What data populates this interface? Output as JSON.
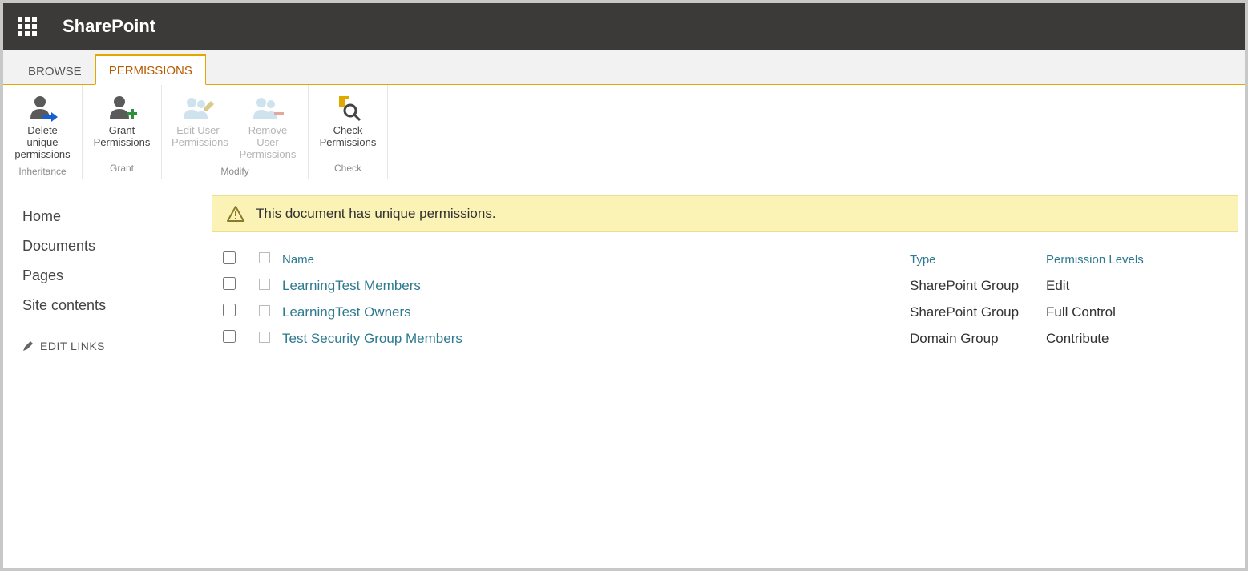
{
  "suite": {
    "title": "SharePoint"
  },
  "tabs": {
    "browse": "BROWSE",
    "permissions": "PERMISSIONS"
  },
  "ribbon": {
    "deleteUnique": {
      "line1": "Delete unique",
      "line2": "permissions"
    },
    "grant": {
      "line1": "Grant",
      "line2": "Permissions"
    },
    "editUser": {
      "line1": "Edit User",
      "line2": "Permissions"
    },
    "removeUser": {
      "line1": "Remove User",
      "line2": "Permissions"
    },
    "check": {
      "line1": "Check",
      "line2": "Permissions"
    },
    "groups": {
      "inheritance": "Inheritance",
      "grant": "Grant",
      "modify": "Modify",
      "check": "Check"
    }
  },
  "nav": {
    "items": [
      "Home",
      "Documents",
      "Pages",
      "Site contents"
    ],
    "editLinks": "EDIT LINKS"
  },
  "notice": {
    "text": "This document has unique permissions."
  },
  "table": {
    "headers": {
      "name": "Name",
      "type": "Type",
      "level": "Permission Levels"
    },
    "rows": [
      {
        "name": "LearningTest Members",
        "type": "SharePoint Group",
        "level": "Edit"
      },
      {
        "name": "LearningTest Owners",
        "type": "SharePoint Group",
        "level": "Full Control"
      },
      {
        "name": "Test Security Group Members",
        "type": "Domain Group",
        "level": "Contribute"
      }
    ]
  }
}
